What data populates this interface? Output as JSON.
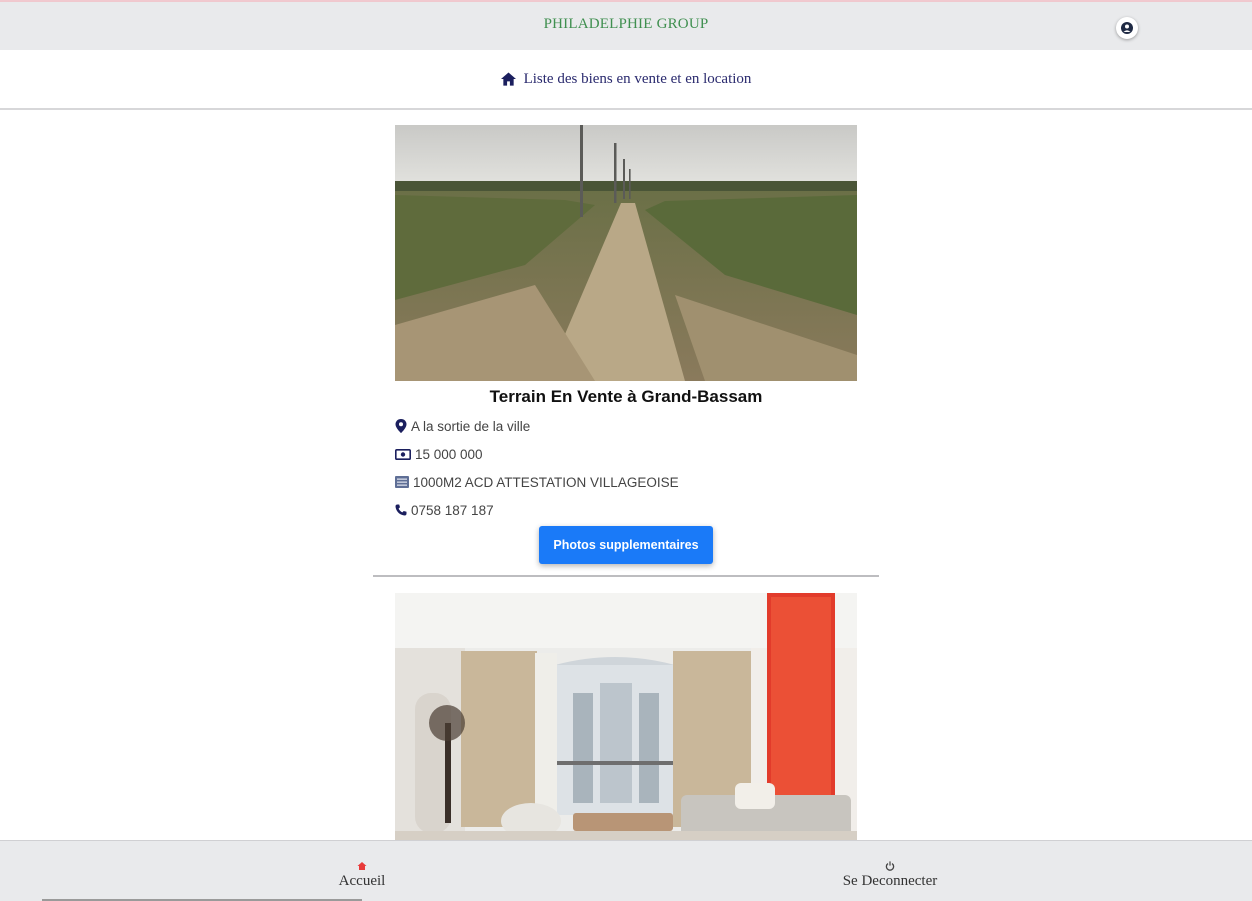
{
  "app": {
    "brand": "PHILADELPHIE GROUP"
  },
  "header": {
    "title": "Liste des biens en vente et en location"
  },
  "listings": [
    {
      "title": "Terrain En Vente à Grand-Bassam",
      "location": "A la sortie de la ville",
      "price": "15 000 000",
      "details": "1000M2 ACD ATTESTATION VILLAGEOISE",
      "phone": "0758 187 187",
      "button_label": "Photos supplementaires"
    },
    {
      "photo": "living-room-photo"
    }
  ],
  "bottom_nav": {
    "home_label": "Accueil",
    "logout_label": "Se Deconnecter"
  },
  "colors": {
    "brand": "#3f8f4f",
    "accent": "#1a7af8",
    "heading": "#2a2a6e",
    "home_icon": "#e83a3a"
  }
}
